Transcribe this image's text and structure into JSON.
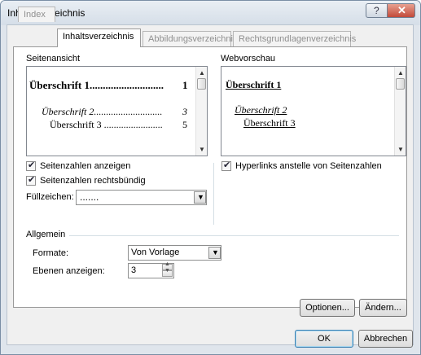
{
  "window": {
    "title": "Inhaltsverzeichnis"
  },
  "titlebar": {
    "help_glyph": "?",
    "close_glyph": "✕"
  },
  "tabs": [
    {
      "label": "Index"
    },
    {
      "label": "Inhaltsverzeichnis"
    },
    {
      "label": "Abbildungsverzeichnis"
    },
    {
      "label": "Rechtsgrundlagenverzeichnis"
    }
  ],
  "seitenansicht": {
    "label": "Seitenansicht",
    "lines": [
      {
        "text": "Überschrift 1............................",
        "page": "1"
      },
      {
        "text": "Überschrift 2............................",
        "page": "3"
      },
      {
        "text": "Überschrift 3 ........................",
        "page": "5"
      }
    ]
  },
  "webvorschau": {
    "label": "Webvorschau",
    "lines": [
      "Überschrift 1",
      "Überschrift 2",
      "Überschrift 3"
    ]
  },
  "options": {
    "show_page_numbers": {
      "label": "Seitenzahlen anzeigen",
      "checked": true
    },
    "right_align": {
      "label": "Seitenzahlen rechtsbündig",
      "checked": true
    },
    "fill_char_label": "Füllzeichen:",
    "fill_char_value": ".......",
    "hyperlinks": {
      "label": "Hyperlinks anstelle von Seitenzahlen",
      "checked": true
    }
  },
  "allgemein": {
    "label": "Allgemein",
    "formats_label": "Formate:",
    "formats_value": "Von Vorlage",
    "levels_label": "Ebenen anzeigen:",
    "levels_value": "3"
  },
  "buttons": {
    "options": "Optionen...",
    "modify": "Ändern...",
    "ok": "OK",
    "cancel": "Abbrechen"
  },
  "glyphs": {
    "check": "✔",
    "down": "▼",
    "up": "▲",
    "spin_up": "▲",
    "spin_down": "▼"
  }
}
